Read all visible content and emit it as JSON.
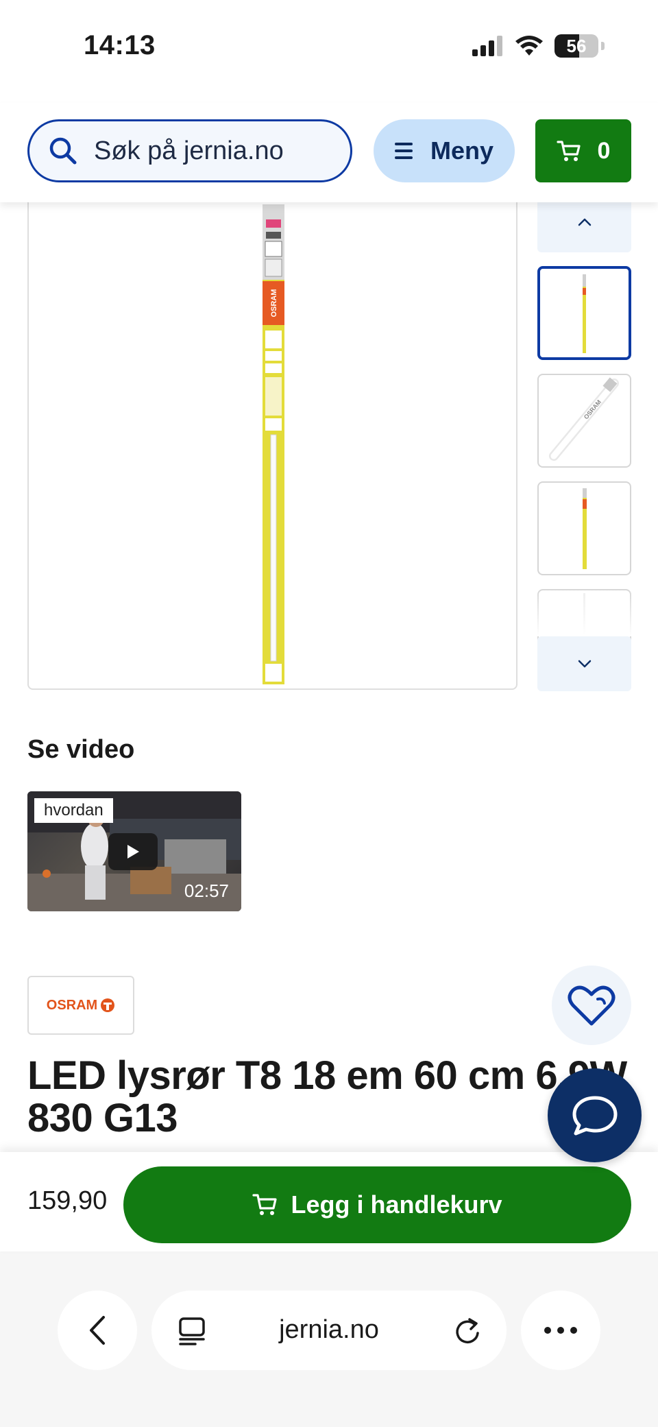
{
  "status_bar": {
    "time": "14:13",
    "battery": "56",
    "battery_level": 0.56
  },
  "header": {
    "search_placeholder": "Søk på jernia.no",
    "menu_label": "Meny",
    "cart_count": "0"
  },
  "gallery": {
    "thumbnails": [
      "tube-package",
      "tube-bare",
      "tube-package-small",
      "tube-bare-small"
    ],
    "active_index": 0
  },
  "video": {
    "heading": "Se video",
    "tag": "hvordan",
    "duration": "02:57"
  },
  "product": {
    "brand": "OSRAM",
    "title": "LED lysrør T8 18 em 60 cm 6,9W 830 G13",
    "price": "159,90",
    "add_to_cart_label": "Legg i handlekurv"
  },
  "browser": {
    "url": "jernia.no"
  },
  "colors": {
    "brand_blue": "#0d3aa3",
    "navy": "#0d2f66",
    "green": "#127b12",
    "light_blue": "#c8e1fa",
    "osram_orange": "#e2541b",
    "package_yellow": "#e3dc3a"
  }
}
